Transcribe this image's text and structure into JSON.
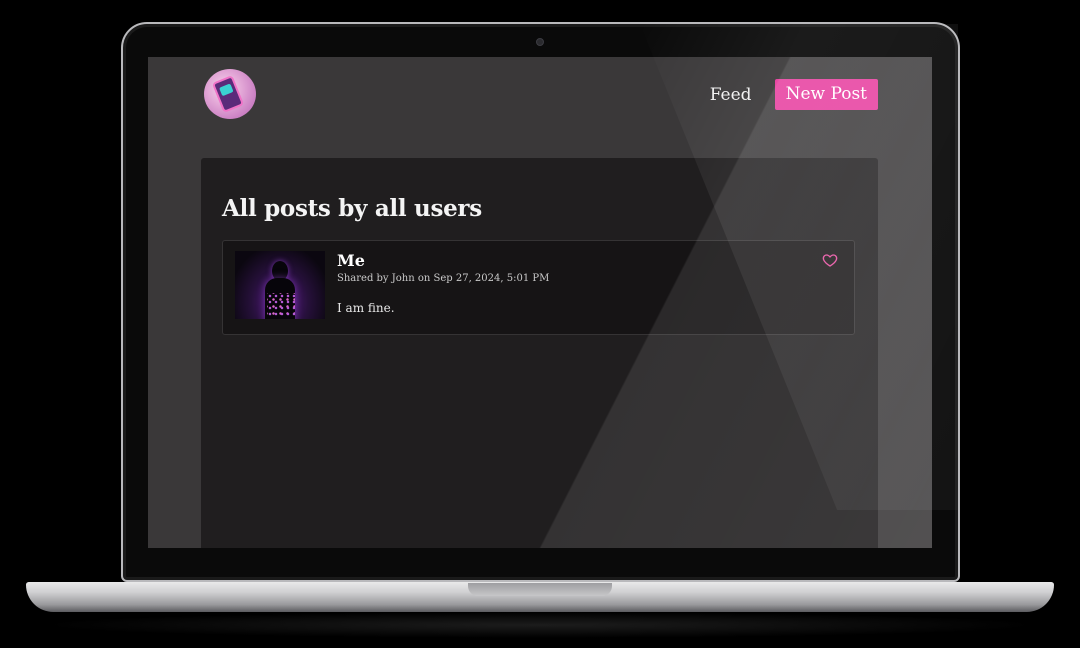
{
  "header": {
    "logo_icon": "phone-app-logo",
    "nav": {
      "feed_label": "Feed",
      "new_post_label": "New Post"
    }
  },
  "main": {
    "title": "All posts by all users",
    "posts": [
      {
        "title": "Me",
        "meta": "Shared by John on Sep 27, 2024, 5:01 PM",
        "body": "I am fine.",
        "like_icon": "heart-outline-icon"
      }
    ]
  },
  "colors": {
    "accent": "#e73a9d",
    "page_bg": "#3a3839",
    "panel_bg": "#201e1f",
    "card_bg": "#161415"
  }
}
